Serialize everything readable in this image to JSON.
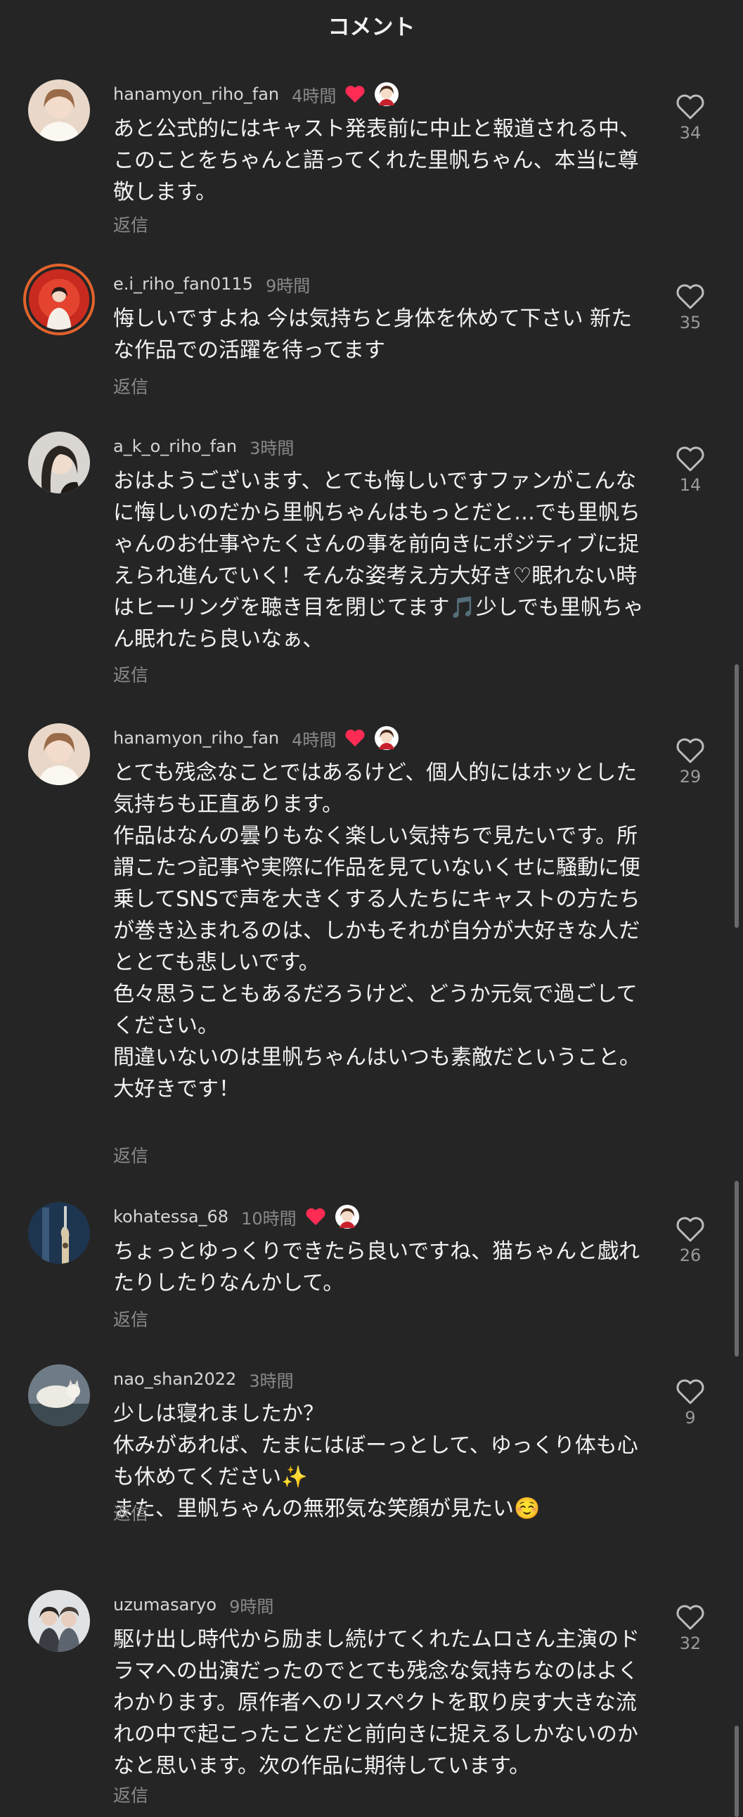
{
  "header": {
    "title": "コメント"
  },
  "reply_label": "返信",
  "comments": [
    {
      "username": "hanamyon_riho_fan",
      "time": "4時間",
      "creator_liked": true,
      "text": "あと公式的にはキャスト発表前に中止と報道される中、このことをちゃんと語ってくれた里帆ちゃん、本当に尊敬します。",
      "likes": "34"
    },
    {
      "username": "e.i_riho_fan0115",
      "time": "9時間",
      "creator_liked": false,
      "text": "悔しいですよね 今は気持ちと身体を休めて下さい 新たな作品での活躍を待ってます",
      "likes": "35"
    },
    {
      "username": "a_k_o_riho_fan",
      "time": "3時間",
      "creator_liked": false,
      "text": "おはようございます、とても悔しいですファンがこんなに悔しいのだから里帆ちゃんはもっとだと…でも里帆ちゃんのお仕事やたくさんの事を前向きにポジティブに捉えられ進んでいく！そんな姿考え方大好き♡眠れない時はヒーリングを聴き目を閉じてます🎵少しでも里帆ちゃん眠れたら良いなぁ、",
      "likes": "14"
    },
    {
      "username": "hanamyon_riho_fan",
      "time": "4時間",
      "creator_liked": true,
      "text": "とても残念なことではあるけど、個人的にはホッとした気持ちも正直あります。\n作品はなんの曇りもなく楽しい気持ちで見たいです。所謂こたつ記事や実際に作品を見ていないくせに騒動に便乗してSNSで声を大きくする人たちにキャストの方たちが巻き込まれるのは、しかもそれが自分が大好きな人だととても悲しいです。\n色々思うこともあるだろうけど、どうか元気で過ごしてください。\n間違いないのは里帆ちゃんはいつも素敵だということ。\n大好きです！",
      "likes": "29"
    },
    {
      "username": "kohatessa_68",
      "time": "10時間",
      "creator_liked": true,
      "text": "ちょっとゆっくりできたら良いですね、猫ちゃんと戯れたりしたりなんかして。",
      "likes": "26"
    },
    {
      "username": "nao_shan2022",
      "time": "3時間",
      "creator_liked": false,
      "text": "少しは寝れましたか？\n休みがあれば、たまにはぼーっとして、ゆっくり体も心も休めてください✨\nまた、里帆ちゃんの無邪気な笑顔が見たい☺️",
      "likes": "9"
    },
    {
      "username": "uzumasaryo",
      "time": "9時間",
      "creator_liked": false,
      "text": "駆け出し時代から励まし続けてくれたムロさん主演のドラマへの出演だったのでとても残念な気持ちなのはよくわかります。原作者へのリスペクトを取り戻す大きな流れの中で起こったことだと前向きに捉えるしかないのかなと思います。次の作品に期待しています。",
      "likes": "32"
    }
  ],
  "icons": {
    "like": "heart-outline-icon",
    "creator_liked": "red-heart-icon",
    "creator": "creator-avatar-icon"
  },
  "colors": {
    "background": "#252525",
    "creator_heart": "#fe2c55",
    "ring": "#e2632c"
  }
}
